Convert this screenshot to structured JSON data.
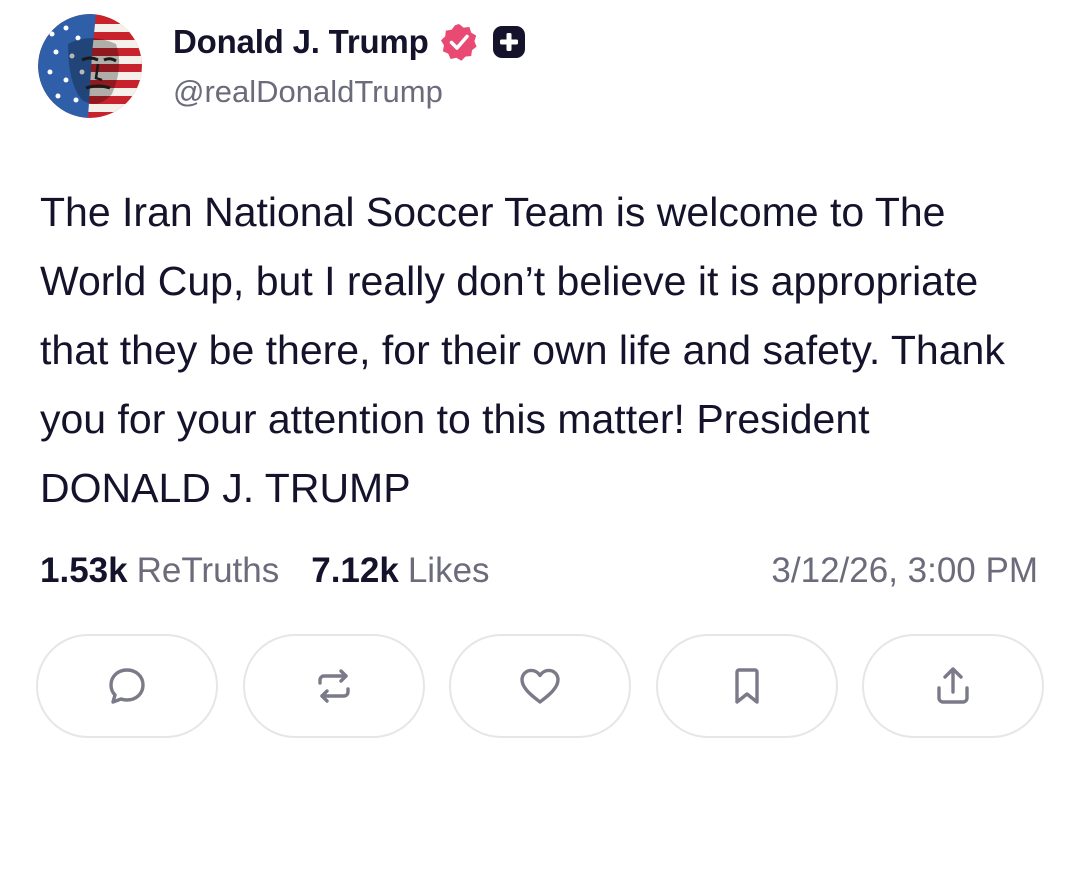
{
  "author": {
    "display_name": "Donald J. Trump",
    "handle": "@realDonaldTrump",
    "avatar_icon": "avatar-flag-portrait",
    "verified_icon": "verified-badge-icon",
    "verified_color": "#e84a73",
    "extra_badge_icon": "plus-square-icon"
  },
  "post": {
    "text": "The Iran National Soccer Team is welcome to The World Cup, but I really don’t believe it is appropriate that they be there, for their own life and safety. Thank you for your attention to this matter! President DONALD J. TRUMP"
  },
  "stats": {
    "retruths_count": "1.53k",
    "retruths_label": "ReTruths",
    "likes_count": "7.12k",
    "likes_label": "Likes",
    "timestamp": "3/12/26, 3:00 PM"
  },
  "actions": [
    {
      "icon": "reply-icon"
    },
    {
      "icon": "retruth-icon"
    },
    {
      "icon": "like-heart-icon"
    },
    {
      "icon": "bookmark-icon"
    },
    {
      "icon": "share-icon"
    }
  ],
  "colors": {
    "text_primary": "#14132b",
    "text_secondary": "#6b6b7b",
    "button_border": "#e6e6ea",
    "icon_color": "#7a7a88"
  }
}
